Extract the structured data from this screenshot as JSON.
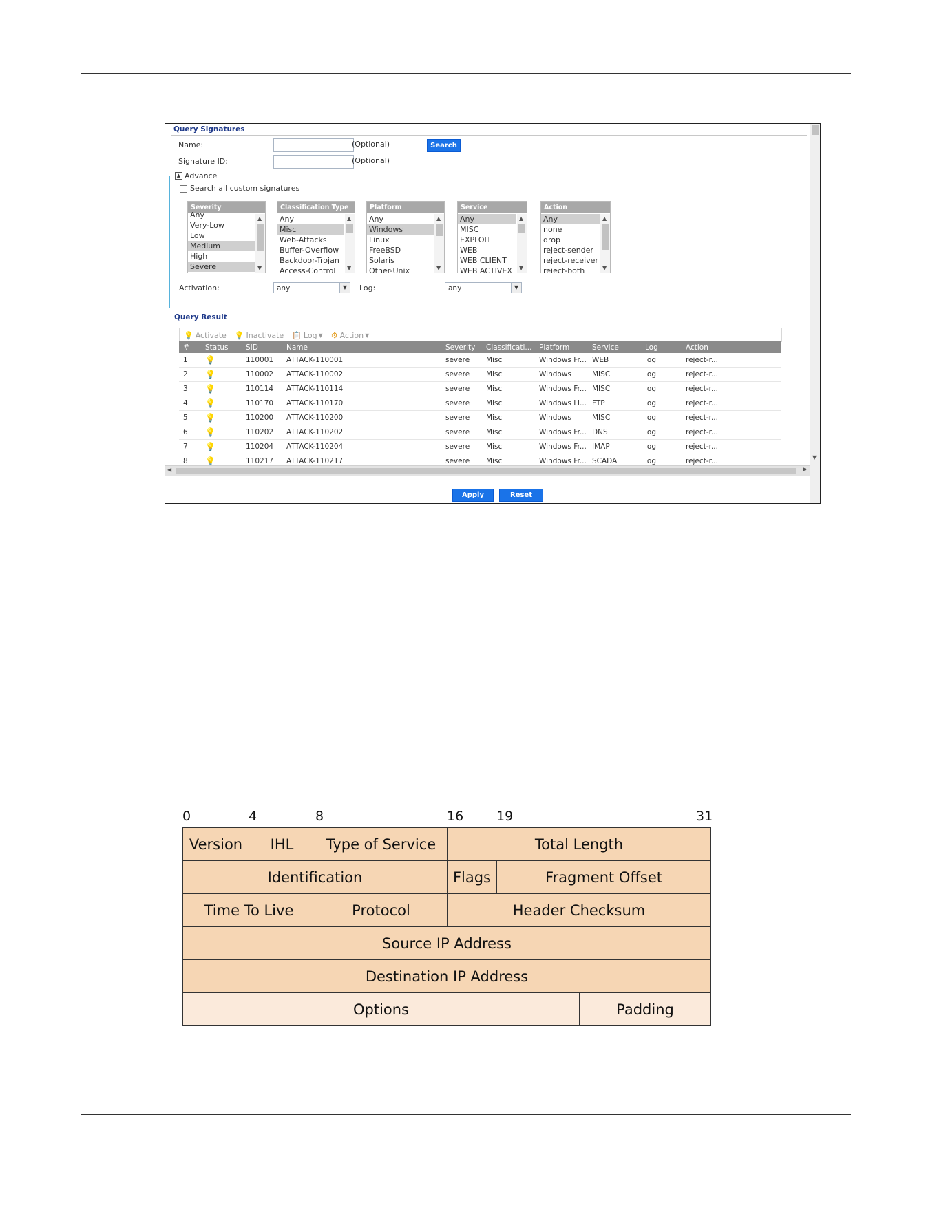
{
  "query_signatures": {
    "title": "Query Signatures",
    "name_label": "Name:",
    "name_value": "",
    "name_hint": "(Optional)",
    "search_button": "Search",
    "sid_label": "Signature ID:",
    "sid_value": "",
    "sid_hint": "(Optional)",
    "advance_label": "Advance",
    "custom_checkbox_label": "Search all custom signatures",
    "lists": {
      "severity": {
        "header": "Severity",
        "items": [
          "Any",
          "Very-Low",
          "Low",
          "Medium",
          "High",
          "Severe"
        ]
      },
      "classification": {
        "header": "Classification Type",
        "items": [
          "Any",
          "Misc",
          "Web-Attacks",
          "Buffer-Overflow",
          "Backdoor-Trojan",
          "Access-Control"
        ]
      },
      "platform": {
        "header": "Platform",
        "items": [
          "Any",
          "Windows",
          "Linux",
          "FreeBSD",
          "Solaris",
          "Other-Unix"
        ]
      },
      "service": {
        "header": "Service",
        "items": [
          "Any",
          "MISC",
          "EXPLOIT",
          "WEB",
          "WEB CLIENT",
          "WEB ACTIVEX"
        ]
      },
      "action": {
        "header": "Action",
        "items": [
          "Any",
          "none",
          "drop",
          "reject-sender",
          "reject-receiver",
          "reject-both"
        ]
      }
    },
    "activation_label": "Activation:",
    "activation_value": "any",
    "log_label": "Log:",
    "log_value": "any"
  },
  "query_result": {
    "title": "Query Result",
    "toolbar": {
      "activate": "Activate",
      "inactivate": "Inactivate",
      "log": "Log",
      "action": "Action"
    },
    "columns": [
      "#",
      "Status",
      "SID",
      "Name",
      "Severity",
      "Classificati...",
      "Platform",
      "Service",
      "Log",
      "Action"
    ],
    "rows": [
      [
        "1",
        "110001",
        "ATTACK-110001",
        "severe",
        "Misc",
        "Windows Fr...",
        "WEB",
        "log",
        "reject-r..."
      ],
      [
        "2",
        "110002",
        "ATTACK-110002",
        "severe",
        "Misc",
        "Windows",
        "MISC",
        "log",
        "reject-r..."
      ],
      [
        "3",
        "110114",
        "ATTACK-110114",
        "severe",
        "Misc",
        "Windows Fr...",
        "MISC",
        "log",
        "reject-r..."
      ],
      [
        "4",
        "110170",
        "ATTACK-110170",
        "severe",
        "Misc",
        "Windows Li...",
        "FTP",
        "log",
        "reject-r..."
      ],
      [
        "5",
        "110200",
        "ATTACK-110200",
        "severe",
        "Misc",
        "Windows",
        "MISC",
        "log",
        "reject-r..."
      ],
      [
        "6",
        "110202",
        "ATTACK-110202",
        "severe",
        "Misc",
        "Windows Fr...",
        "DNS",
        "log",
        "reject-r..."
      ],
      [
        "7",
        "110204",
        "ATTACK-110204",
        "severe",
        "Misc",
        "Windows Fr...",
        "IMAP",
        "log",
        "reject-r..."
      ],
      [
        "8",
        "110217",
        "ATTACK-110217",
        "severe",
        "Misc",
        "Windows Fr...",
        "SCADA",
        "log",
        "reject-r..."
      ]
    ]
  },
  "buttons": {
    "apply": "Apply",
    "reset": "Reset"
  },
  "diagram": {
    "bit_numbers": [
      "0",
      "4",
      "8",
      "16",
      "19",
      "31"
    ],
    "fields": {
      "version": "Version",
      "ihl": "IHL",
      "tos": "Type of Service",
      "total_length": "Total Length",
      "identification": "Identification",
      "flags": "Flags",
      "fragment_offset": "Fragment Offset",
      "ttl": "Time To Live",
      "protocol": "Protocol",
      "header_checksum": "Header Checksum",
      "source_ip": "Source IP Address",
      "dest_ip": "Destination IP Address",
      "options": "Options",
      "padding": "Padding"
    }
  },
  "colors": {
    "accent": "#1a73e8",
    "field_fill": "#f6d6b4",
    "field_fill_light": "#fbeadb",
    "fieldset_border": "#57b3dc"
  }
}
